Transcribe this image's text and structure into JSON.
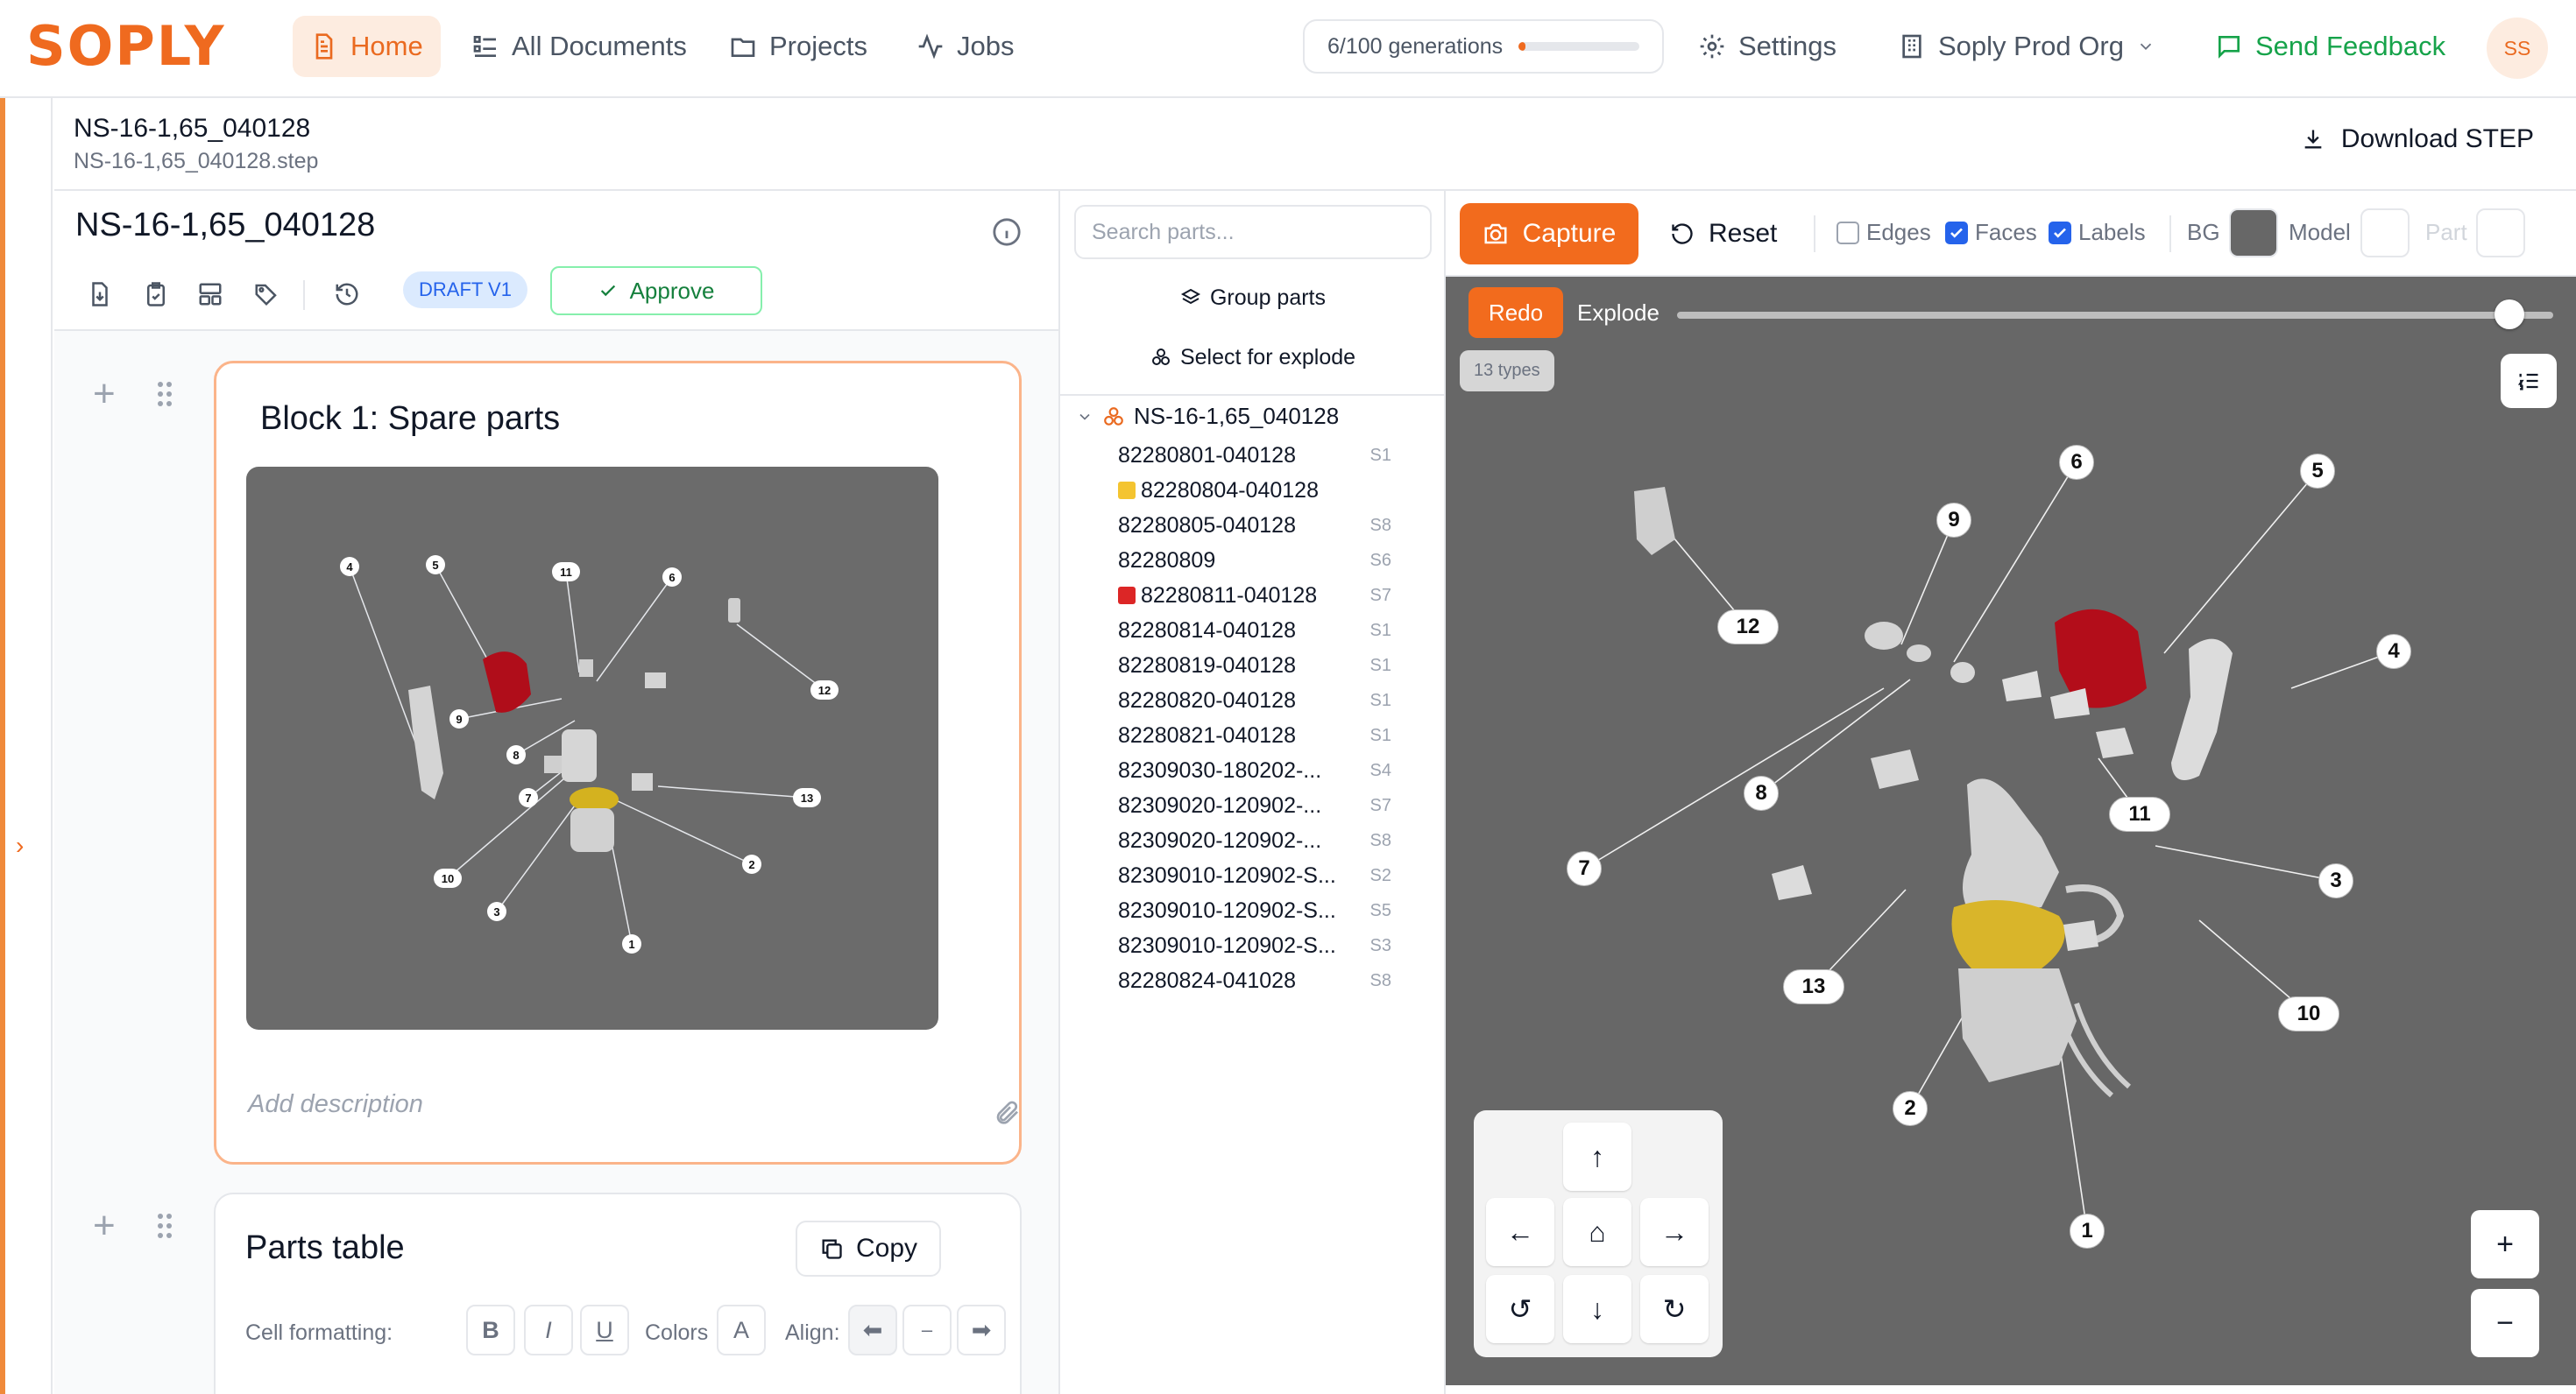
{
  "brand": {
    "logo": "SOPLY",
    "accent": "#ef6a1f"
  },
  "nav": {
    "home": "Home",
    "all_documents": "All Documents",
    "projects": "Projects",
    "jobs": "Jobs",
    "generations": "6/100 generations",
    "generations_progress": 0.06,
    "settings": "Settings",
    "org": "Soply Prod Org",
    "feedback": "Send Feedback",
    "avatar": "SS"
  },
  "document": {
    "title": "NS-16-1,65_040128",
    "file": "NS-16-1,65_040128.step",
    "download": "Download STEP"
  },
  "editor": {
    "title": "NS-16-1,65_040128",
    "status_badge": "DRAFT V1",
    "approve": "Approve",
    "block1": {
      "title": "Block 1: Spare parts",
      "description_placeholder": "Add description",
      "callouts": [
        "4",
        "5",
        "11",
        "6",
        "12",
        "9",
        "8",
        "7",
        "13",
        "10",
        "3",
        "1",
        "2"
      ]
    },
    "block2": {
      "title": "Parts table",
      "copy": "Copy",
      "cell_formatting": "Cell formatting:",
      "bold": "B",
      "italic": "I",
      "underline": "U",
      "colors": "Colors",
      "color_btn": "A",
      "align": "Align:"
    }
  },
  "tree": {
    "search_placeholder": "Search parts...",
    "group_parts": "Group parts",
    "select_explode": "Select for explode",
    "root": "NS-16-1,65_040128",
    "items": [
      {
        "name": "82280801-040128",
        "tag": "S1",
        "color": ""
      },
      {
        "name": "82280804-040128",
        "tag": "",
        "color": "#f4c430"
      },
      {
        "name": "82280805-040128",
        "tag": "S8",
        "color": ""
      },
      {
        "name": "82280809",
        "tag": "S6",
        "color": ""
      },
      {
        "name": "82280811-040128",
        "tag": "S7",
        "color": "#dc2626"
      },
      {
        "name": "82280814-040128",
        "tag": "S1",
        "color": ""
      },
      {
        "name": "82280819-040128",
        "tag": "S1",
        "color": ""
      },
      {
        "name": "82280820-040128",
        "tag": "S1",
        "color": ""
      },
      {
        "name": "82280821-040128",
        "tag": "S1",
        "color": ""
      },
      {
        "name": "82309030-180202-...",
        "tag": "S4",
        "color": ""
      },
      {
        "name": "82309020-120902-...",
        "tag": "S7",
        "color": ""
      },
      {
        "name": "82309020-120902-...",
        "tag": "S8",
        "color": ""
      },
      {
        "name": "82309010-120902-S...",
        "tag": "S2",
        "color": ""
      },
      {
        "name": "82309010-120902-S...",
        "tag": "S5",
        "color": ""
      },
      {
        "name": "82309010-120902-S...",
        "tag": "S3",
        "color": ""
      },
      {
        "name": "82280824-041028",
        "tag": "S8",
        "color": ""
      }
    ]
  },
  "viewer": {
    "capture": "Capture",
    "reset": "Reset",
    "edges": "Edges",
    "faces": "Faces",
    "labels": "Labels",
    "edges_on": false,
    "faces_on": true,
    "labels_on": true,
    "bg_label": "BG",
    "model_label": "Model",
    "part_label": "Part",
    "bg_color": "#676767",
    "model_color": "#ffffff",
    "part_color": "#ffffff",
    "redo": "Redo",
    "explode": "Explode",
    "explode_value": 0.95,
    "types_chip": "13 types",
    "zoom_in": "+",
    "zoom_out": "−",
    "callouts": [
      "12",
      "9",
      "6",
      "5",
      "4",
      "8",
      "7",
      "11",
      "3",
      "13",
      "10",
      "2",
      "1"
    ]
  }
}
